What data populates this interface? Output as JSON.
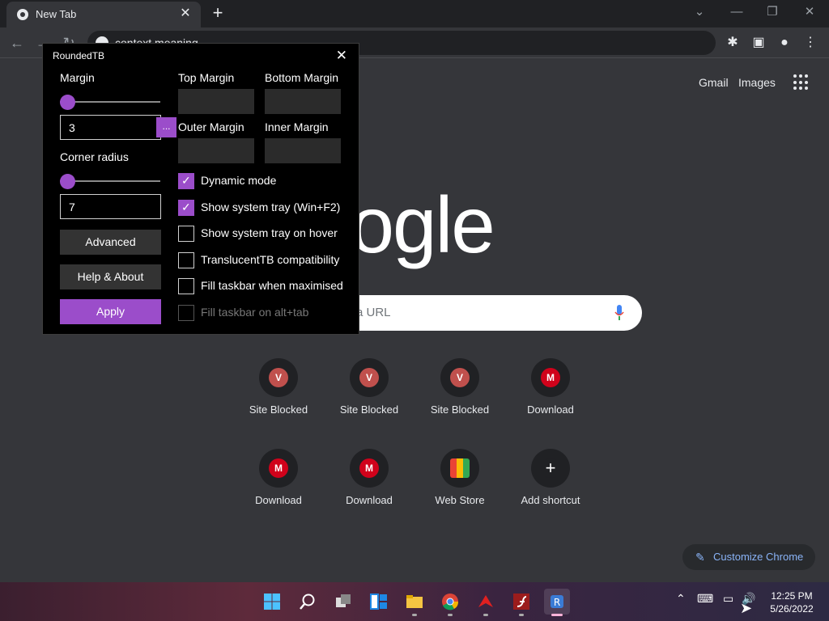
{
  "browser": {
    "tab_title": "New Tab",
    "tab_close": "✕",
    "new_tab": "+",
    "omnibox_text": "context meaning",
    "window_controls": {
      "dropdown": "⌄",
      "minimize": "—",
      "restore": "❐",
      "close": "✕"
    }
  },
  "page": {
    "links": {
      "gmail": "Gmail",
      "images": "Images"
    },
    "logo_text": "oogle",
    "search_placeholder": "a URL",
    "shortcuts": [
      {
        "label": "Site Blocked",
        "glyph": "V",
        "color": "#c0504d"
      },
      {
        "label": "Site Blocked",
        "glyph": "V",
        "color": "#c0504d"
      },
      {
        "label": "Site Blocked",
        "glyph": "V",
        "color": "#c0504d"
      },
      {
        "label": "Download",
        "glyph": "M",
        "color": "#d0021b"
      },
      {
        "label": "Download",
        "glyph": "M",
        "color": "#d0021b"
      },
      {
        "label": "Download",
        "glyph": "M",
        "color": "#d0021b"
      },
      {
        "label": "Web Store",
        "glyph": "",
        "color": "#e8eaed"
      },
      {
        "label": "Add shortcut",
        "glyph": "+",
        "color": "#202124"
      }
    ],
    "customize": "Customize Chrome"
  },
  "dialog": {
    "title": "RoundedTB",
    "close": "✕",
    "margin_label": "Margin",
    "margin_value": "3",
    "margin_more": "...",
    "corner_label": "Corner radius",
    "corner_value": "7",
    "advanced": "Advanced",
    "help": "Help & About",
    "apply": "Apply",
    "top_margin": "Top Margin",
    "bottom_margin": "Bottom Margin",
    "outer_margin": "Outer Margin",
    "inner_margin": "Inner Margin",
    "checkboxes": [
      {
        "label": "Dynamic mode",
        "checked": true,
        "enabled": true
      },
      {
        "label": "Show system tray (Win+F2)",
        "checked": true,
        "enabled": true
      },
      {
        "label": "Show system tray on hover",
        "checked": false,
        "enabled": true
      },
      {
        "label": "TranslucentTB compatibility",
        "checked": false,
        "enabled": true
      },
      {
        "label": "Fill taskbar when maximised",
        "checked": false,
        "enabled": true
      },
      {
        "label": "Fill taskbar on alt+tab",
        "checked": false,
        "enabled": false
      }
    ],
    "accent_color": "#9b4dca"
  },
  "taskbar": {
    "time": "12:25 PM",
    "date": "5/26/2022"
  }
}
